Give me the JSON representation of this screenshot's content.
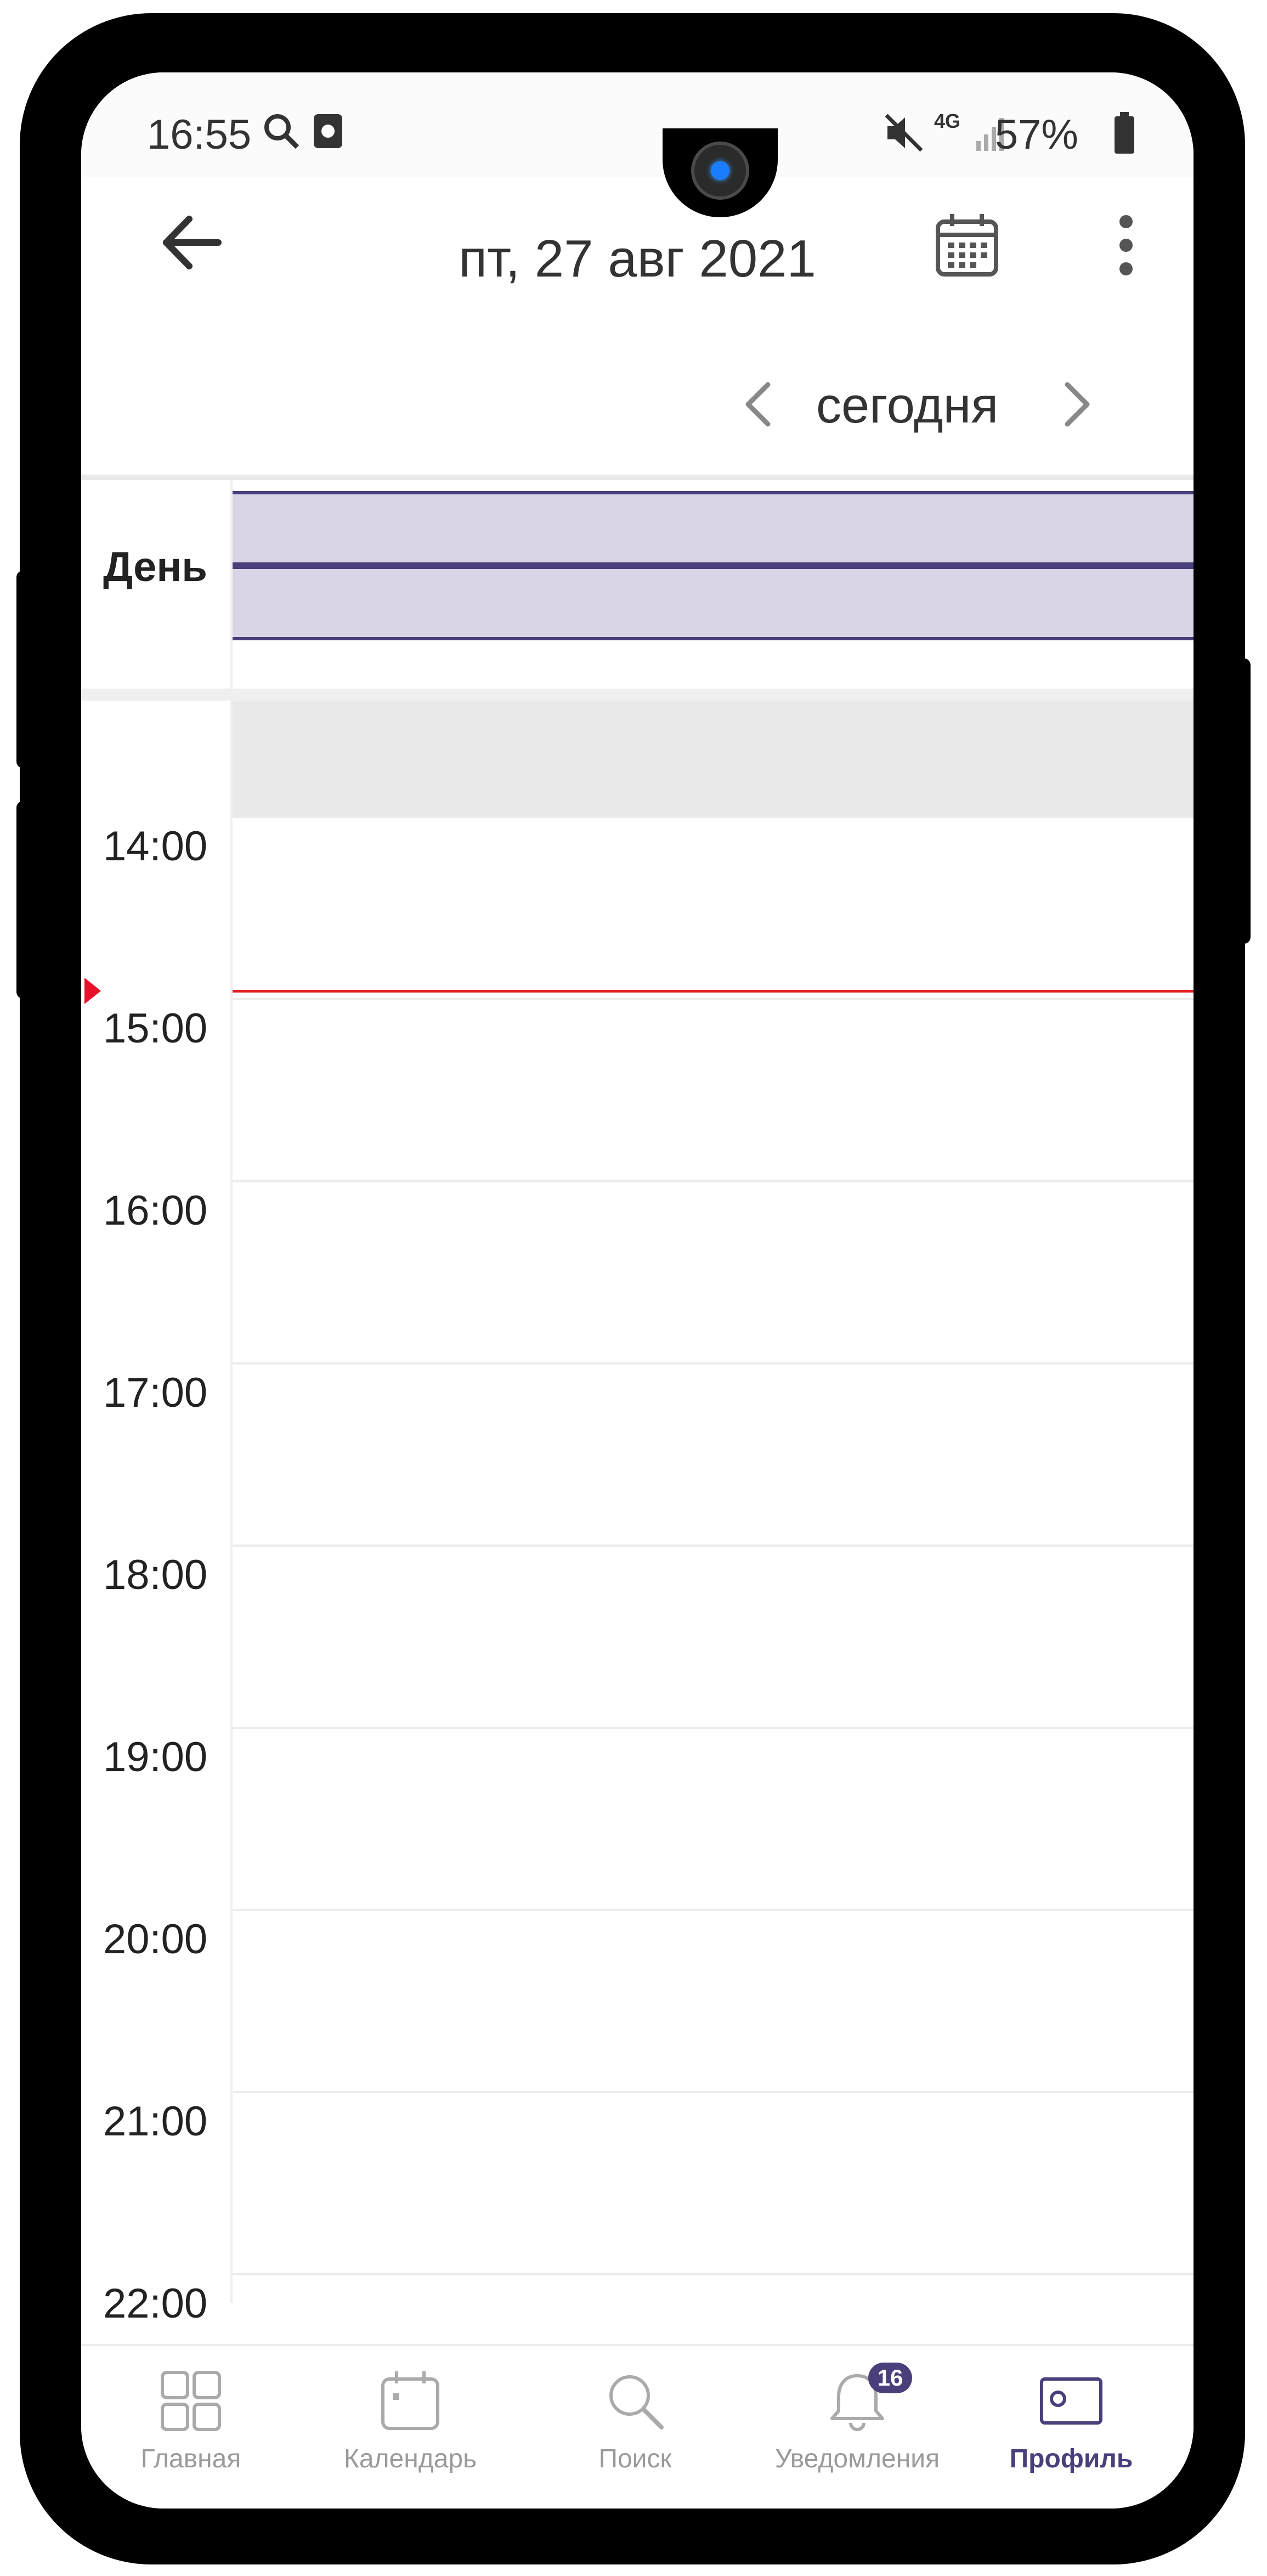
{
  "status_bar": {
    "time": "16:55",
    "battery": "57%",
    "network": "4G"
  },
  "header": {
    "title": "пт, 27 авг 2021"
  },
  "day_nav": {
    "label": "сегодня"
  },
  "all_day": {
    "label": "День"
  },
  "hours": [
    "14:00",
    "15:00",
    "16:00",
    "17:00",
    "18:00",
    "19:00",
    "20:00",
    "21:00",
    "22:00"
  ],
  "bottom_nav": {
    "items": [
      {
        "label": "Главная",
        "icon": "grid-icon"
      },
      {
        "label": "Календарь",
        "icon": "calendar-icon"
      },
      {
        "label": "Поиск",
        "icon": "search-icon"
      },
      {
        "label": "Уведомления",
        "icon": "bell-icon",
        "badge": "16"
      },
      {
        "label": "Профиль",
        "icon": "profile-card-icon"
      }
    ],
    "active": "Профиль"
  },
  "colors": {
    "accent": "#4a3f7a",
    "event_fill": "#d9d4e6",
    "now_line": "#e02020"
  }
}
